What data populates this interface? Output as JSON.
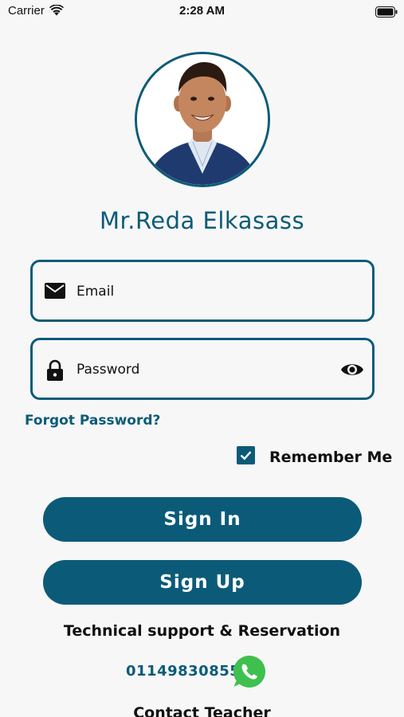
{
  "status_bar": {
    "carrier": "Carrier",
    "time": "2:28 AM"
  },
  "profile": {
    "name": "Mr.Reda Elkasass"
  },
  "login_form": {
    "email_placeholder": "Email",
    "password_placeholder": "Password",
    "forgot_password": "Forgot Password?",
    "remember_me": "Remember Me",
    "remember_me_checked": true
  },
  "actions": {
    "sign_in": "Sign In",
    "sign_up": "Sign Up"
  },
  "support": {
    "title": "Technical support & Reservation",
    "phone": "01149830855",
    "contact_title": "Contact Teacher"
  },
  "icons": {
    "wifi": "wifi-icon",
    "battery": "battery-icon",
    "email": "mail-icon",
    "lock": "lock-icon",
    "eye": "eye-icon",
    "check": "checkbox-checked-icon",
    "whatsapp": "whatsapp-icon"
  },
  "colors": {
    "primary": "#0b5b78",
    "background": "#f7f7f7",
    "whatsapp": "#3fc04e"
  }
}
